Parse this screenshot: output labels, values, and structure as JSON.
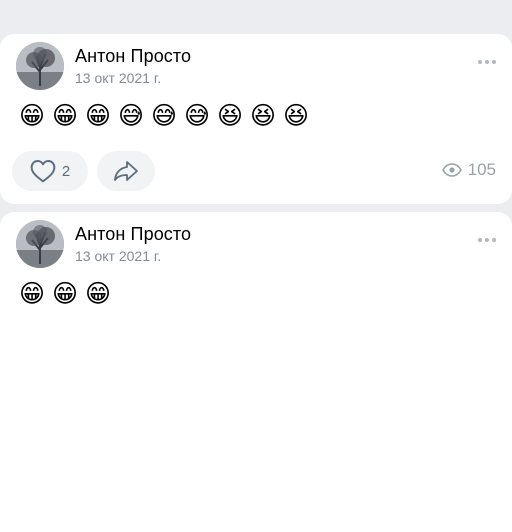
{
  "posts": [
    {
      "author": "Антон Просто",
      "date": "13 окт 2021 г.",
      "emojis": [
        "😁",
        "😁",
        "😁",
        "😅",
        "😅",
        "😅",
        "😆",
        "😆",
        "😆"
      ],
      "likes": "2",
      "views": "105"
    },
    {
      "author": "Антон Просто",
      "date": "13 окт 2021 г.",
      "emojis": [
        "😁",
        "😁",
        "😁"
      ]
    }
  ],
  "icons": {
    "like": "heart-outline-icon",
    "share": "share-arrow-icon",
    "views": "eye-icon",
    "more": "more-horizontal-icon"
  },
  "colors": {
    "background": "#ebedf0",
    "card": "#ffffff",
    "secondary_text": "#818c99",
    "action_bg": "#f2f3f5"
  }
}
